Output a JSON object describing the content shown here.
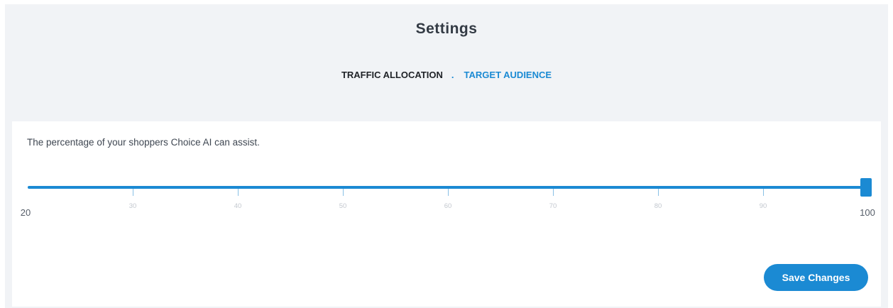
{
  "header": {
    "title": "Settings"
  },
  "tabs": {
    "items": [
      {
        "label": "TRAFFIC ALLOCATION",
        "active": true
      },
      {
        "label": "TARGET AUDIENCE",
        "active": false
      }
    ],
    "separator": "."
  },
  "traffic": {
    "description": "The percentage of your shoppers Choice AI can assist.",
    "slider": {
      "min": 20,
      "max": 100,
      "value": 100,
      "ticks": [
        "20",
        "30",
        "40",
        "50",
        "60",
        "70",
        "80",
        "90",
        "100"
      ]
    }
  },
  "actions": {
    "save_label": "Save Changes"
  },
  "colors": {
    "accent": "#1b8ad3",
    "background": "#f1f3f6"
  }
}
